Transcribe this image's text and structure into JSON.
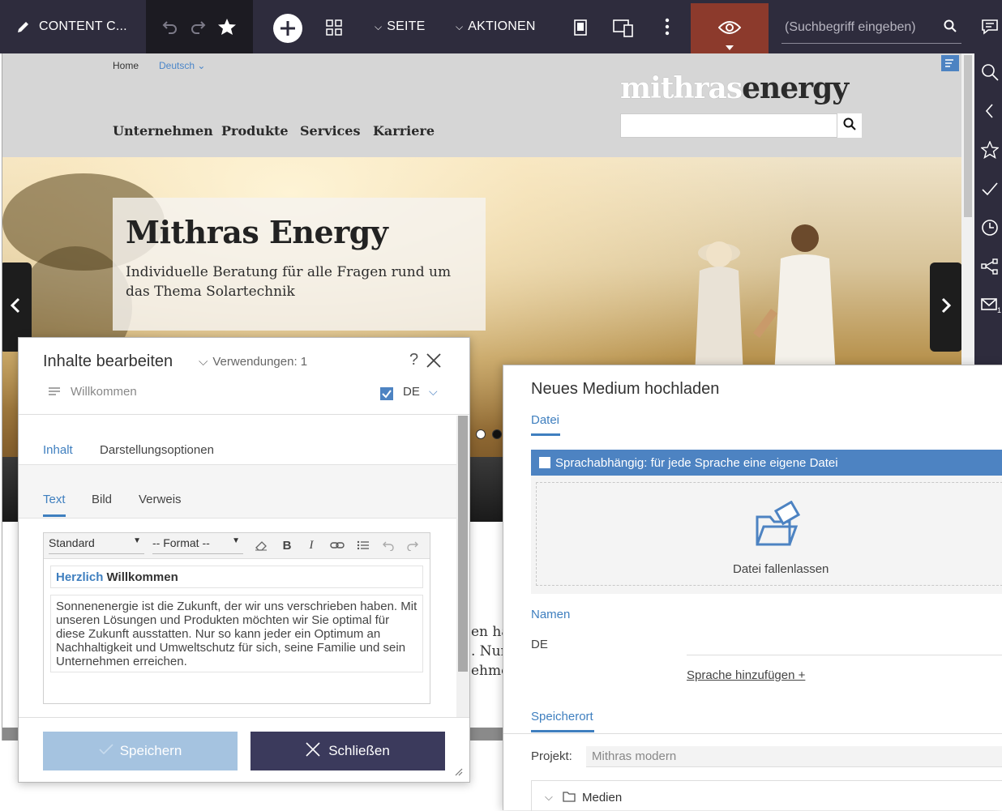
{
  "toolbar": {
    "app_title": "CONTENT C...",
    "page_menu": "SEITE",
    "actions_menu": "AKTIONEN",
    "search_placeholder": "(Suchbegriff eingeben)"
  },
  "site": {
    "breadcrumb_home": "Home",
    "language": "Deutsch",
    "logo_light": "mithras",
    "logo_dark": "energy",
    "nav": [
      "Unternehmen",
      "Produkte",
      "Services",
      "Karriere"
    ],
    "hero_title": "Mithras Energy",
    "hero_subtitle": "Individuelle Beratung für alle Fragen rund um das Thema Solartechnik",
    "fragments": [
      "en ha",
      ". Nur",
      "ehme"
    ]
  },
  "edit_dialog": {
    "title": "Inhalte bearbeiten",
    "usages": "Verwendungen: 1",
    "help": "?",
    "element_name": "Willkommen",
    "language": "DE",
    "tabs": [
      "Inhalt",
      "Darstellungsoptionen"
    ],
    "subtabs": [
      "Text",
      "Bild",
      "Verweis"
    ],
    "style_select": "Standard",
    "format_select": "-- Format --",
    "heading_highlight": "Herzlich",
    "heading_rest": " Willkommen",
    "body_text": "Sonnenenergie ist die Zukunft, der wir uns verschrieben haben. Mit unseren Lösungen und Produkten möchten wir Sie optimal für diese Zukunft ausstatten. Nur so kann jeder ein Optimum an Nachhaltigkeit und Umweltschutz für sich, seine Familie und sein Unternehmen erreichen.",
    "save_label": "Speichern",
    "close_label": "Schließen"
  },
  "upload_dialog": {
    "title": "Neues Medium hochladen",
    "file_section": "Datei",
    "language_dependent": "Sprachabhängig: für jede Sprache eine eigene Datei",
    "drop_label": "Datei fallenlassen",
    "names_section": "Namen",
    "name_lang": "DE",
    "add_language": "Sprache hinzufügen +",
    "location_section": "Speicherort",
    "project_label": "Projekt:",
    "project_value": "Mithras modern",
    "folder": "Medien"
  },
  "colors": {
    "toolbar_bg": "#2e2c3d",
    "preview_active": "#8c3a2c",
    "accent": "#3f7fbf",
    "close_btn": "#3b3a5c",
    "save_btn_disabled": "#a5c3e0"
  }
}
